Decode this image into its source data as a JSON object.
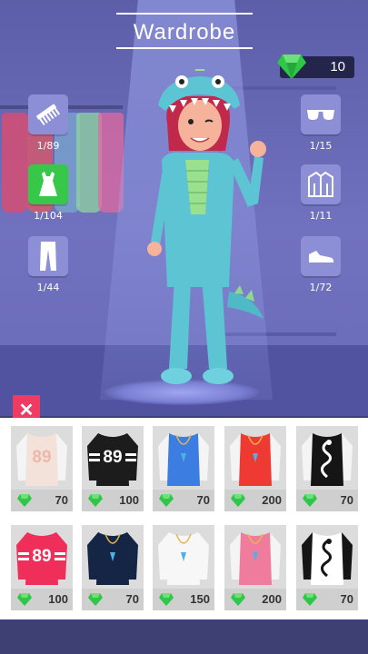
{
  "header": {
    "title": "Wardrobe"
  },
  "currency": {
    "gems": "10"
  },
  "categories_left": [
    {
      "icon": "comb-icon",
      "count": "1/89",
      "active": false
    },
    {
      "icon": "dress-icon",
      "count": "1/104",
      "active": true
    },
    {
      "icon": "pants-icon",
      "count": "1/44",
      "active": false
    }
  ],
  "categories_right": [
    {
      "icon": "sunglasses-icon",
      "count": "1/15"
    },
    {
      "icon": "jacket-icon",
      "count": "1/11"
    },
    {
      "icon": "shoe-icon",
      "count": "1/72"
    }
  ],
  "colors": {
    "active": "#37c84a",
    "close": "#ef3b63",
    "gem": "#2fc64a"
  },
  "items": [
    {
      "price": "70",
      "shirt": "#f2e2d9",
      "sleeve": "#f4f4f4",
      "number": "89",
      "numcolor": "#f0b7a8",
      "deco": "none"
    },
    {
      "price": "100",
      "shirt": "#1c1c1c",
      "sleeve": "#1c1c1c",
      "number": "89",
      "numcolor": "#ffffff",
      "deco": "stripes"
    },
    {
      "price": "70",
      "shirt": "#3b7de0",
      "sleeve": "#f4f4f4",
      "number": "",
      "numcolor": "",
      "deco": "pendant"
    },
    {
      "price": "200",
      "shirt": "#ee3a33",
      "sleeve": "#f4f4f4",
      "number": "",
      "numcolor": "",
      "deco": "pendant"
    },
    {
      "price": "70",
      "shirt": "#151515",
      "sleeve": "#f4f4f4",
      "number": "",
      "numcolor": "",
      "deco": "dragon"
    },
    {
      "price": "100",
      "shirt": "#ef2f5a",
      "sleeve": "#ef2f5a",
      "number": "89",
      "numcolor": "#ffffff",
      "deco": "stripes"
    },
    {
      "price": "70",
      "shirt": "#152546",
      "sleeve": "#152546",
      "number": "",
      "numcolor": "",
      "deco": "pendant"
    },
    {
      "price": "150",
      "shirt": "#f7f7f7",
      "sleeve": "#f7f7f7",
      "number": "",
      "numcolor": "",
      "deco": "pendant"
    },
    {
      "price": "200",
      "shirt": "#ef7c9c",
      "sleeve": "#f4f4f4",
      "number": "",
      "numcolor": "",
      "deco": "pendant"
    },
    {
      "price": "70",
      "shirt": "#ffffff",
      "sleeve": "#151515",
      "number": "",
      "numcolor": "",
      "deco": "dragon"
    }
  ]
}
